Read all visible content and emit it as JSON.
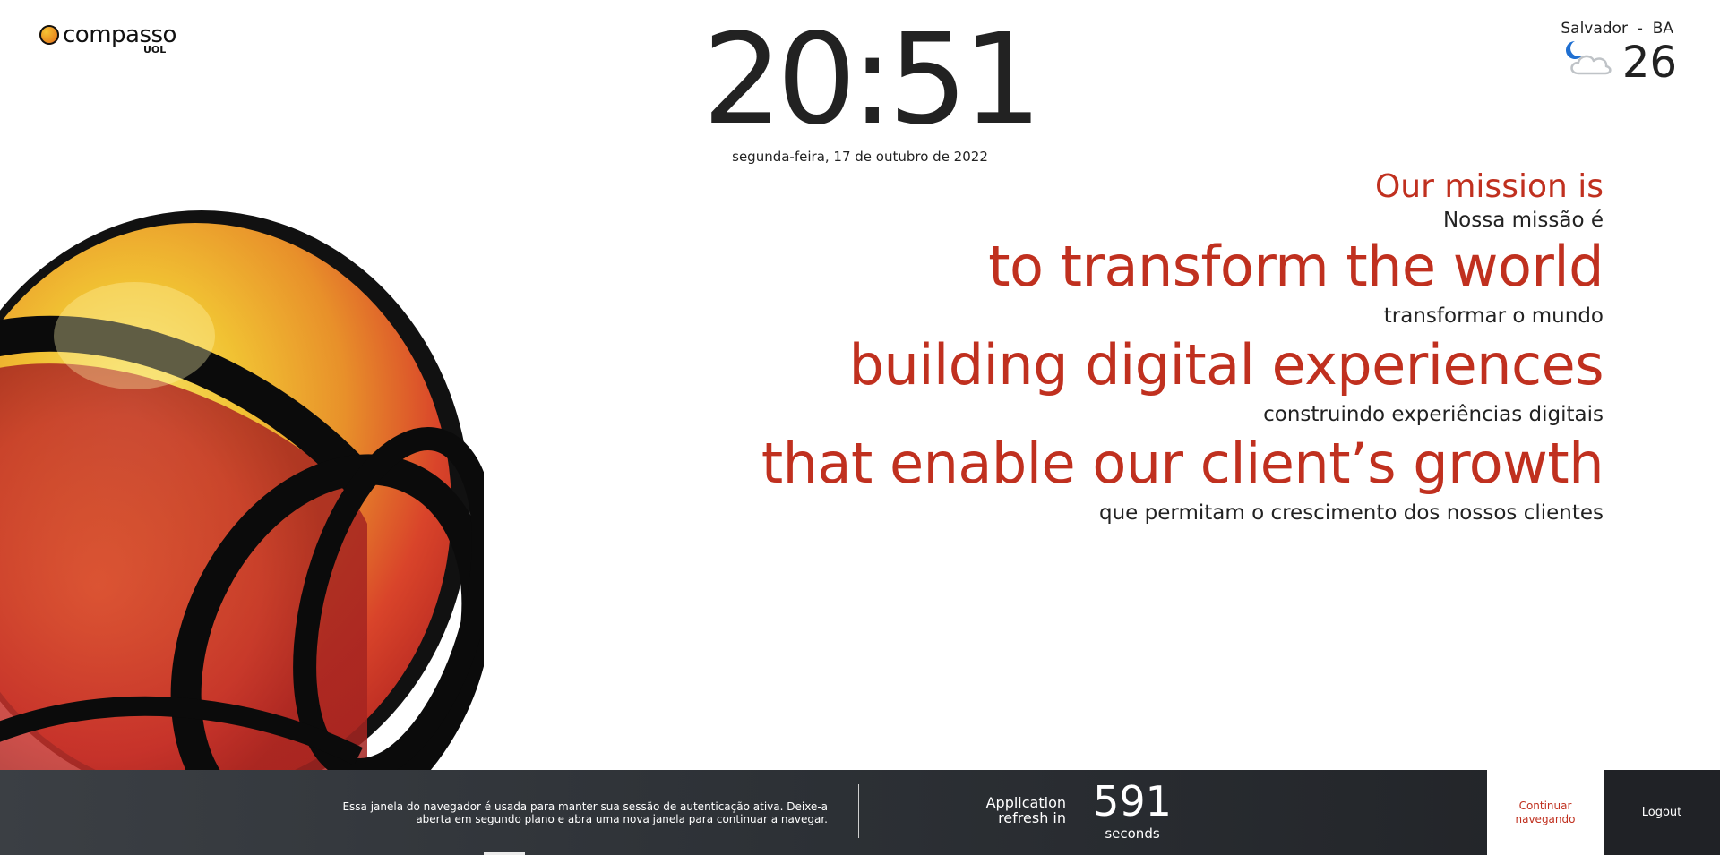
{
  "logo": {
    "wordmark": "compasso",
    "sub": "UOL"
  },
  "clock": {
    "time": "20:51",
    "date": "segunda-feira, 17 de outubro de 2022"
  },
  "weather": {
    "location": "Salvador  -  BA",
    "temperature": "26",
    "icon": "night-cloudy-icon"
  },
  "mission": {
    "heading_en": "Our mission is",
    "heading_pt": "Nossa missão é",
    "lines": [
      {
        "en": "to transform the world",
        "pt": "transformar o mundo"
      },
      {
        "en": "building digital experiences",
        "pt": "construindo experiências digitais"
      },
      {
        "en": "that enable our client’s growth",
        "pt": "que permitam o crescimento dos nossos clientes"
      }
    ]
  },
  "bottom_bar": {
    "message_line1": "Essa janela do navegador é usada para manter sua sessão de autenticação ativa. Deixe-a",
    "message_line2": "aberta em segundo plano e abra uma nova janela para continuar a navegar.",
    "refresh_label_line1": "Application",
    "refresh_label_line2": "refresh in",
    "countdown": "591",
    "countdown_unit": "seconds",
    "continue_label": "Continuar navegando",
    "logout_label": "Logout"
  },
  "colors": {
    "accent_red": "#c0301f",
    "text_dark": "#222222",
    "bar_dark": "#2d3136"
  }
}
